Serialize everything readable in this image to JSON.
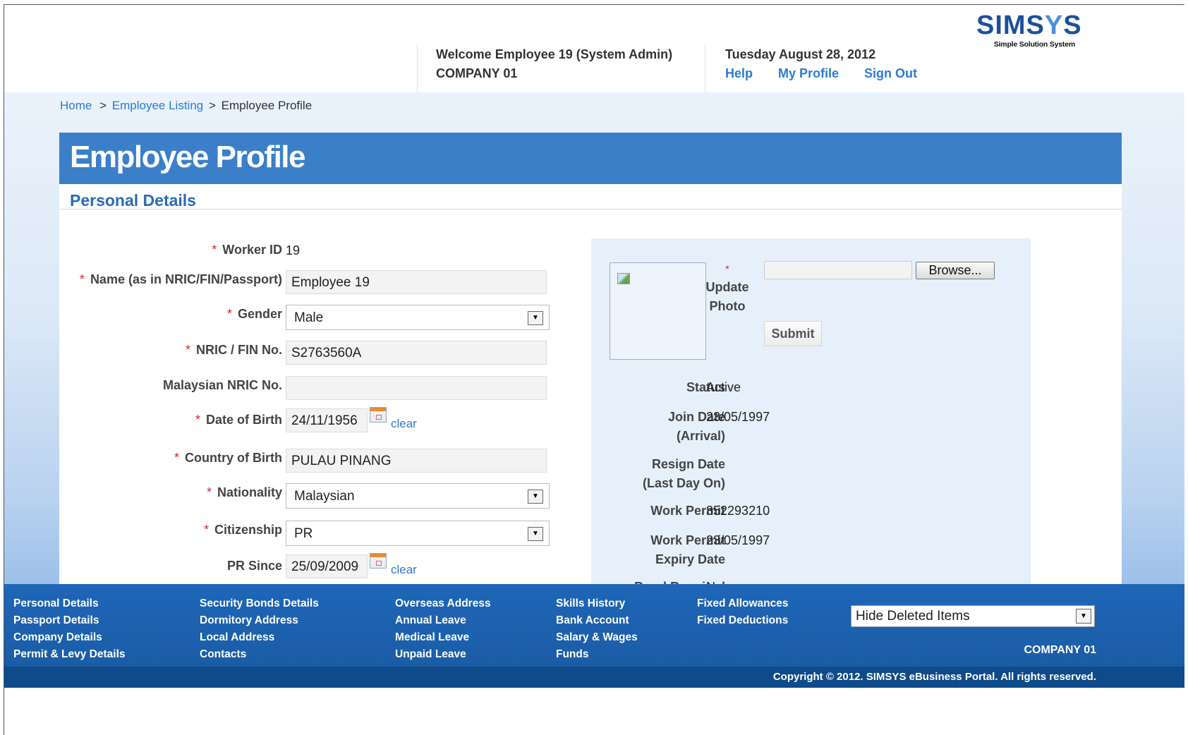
{
  "header": {
    "welcome_line1": "Welcome Employee 19 (System Admin)",
    "welcome_line2": "COMPANY 01",
    "date": "Tuesday August 28, 2012",
    "links": {
      "help": "Help",
      "my_profile": "My Profile",
      "sign_out": "Sign Out"
    },
    "logo": {
      "main_a": "SIMS",
      "main_b": "Y",
      "main_c": "S",
      "sub": "Simple Solution System"
    }
  },
  "breadcrumb": {
    "home": "Home",
    "sep1": ">",
    "listing": "Employee Listing",
    "sep2": ">",
    "current": "Employee Profile"
  },
  "page_title": "Employee Profile",
  "section_title": "Personal Details",
  "form": {
    "worker_id": {
      "label": "Worker ID",
      "value": "19"
    },
    "name": {
      "label": "Name (as in NRIC/FIN/Passport)",
      "value": "Employee 19"
    },
    "gender": {
      "label": "Gender",
      "value": "Male"
    },
    "nric": {
      "label": "NRIC / FIN No.",
      "value": "S2763560A"
    },
    "malaysian_nric": {
      "label": "Malaysian NRIC No.",
      "value": ""
    },
    "dob": {
      "label": "Date of Birth",
      "value": "24/11/1956",
      "clear": "clear"
    },
    "country_of_birth": {
      "label": "Country of Birth",
      "value": "PULAU PINANG"
    },
    "nationality": {
      "label": "Nationality",
      "value": "Malaysian"
    },
    "citizenship": {
      "label": "Citizenship",
      "value": "PR"
    },
    "pr_since": {
      "label": "PR Since",
      "value": "25/09/2009",
      "clear": "clear"
    },
    "required_mark": "*"
  },
  "photo_box": {
    "update_label_line1": "Update",
    "update_label_line2": "Photo",
    "browse": "Browse...",
    "submit": "Submit"
  },
  "info": {
    "status": {
      "label": "Status",
      "value": "Active"
    },
    "join_date": {
      "label1": "Join Date",
      "label2": "(Arrival)",
      "value": "23/05/1997"
    },
    "resign_date": {
      "label1": "Resign Date",
      "label2": "(Last Day On)",
      "value": "-"
    },
    "work_permit": {
      "label": "Work Permit",
      "value": "352293210"
    },
    "wp_expiry": {
      "label1": "Work Permit",
      "label2": "Expiry Date",
      "value": "23/05/1997"
    },
    "bond_required": {
      "label": "Bond Required",
      "value": "No"
    }
  },
  "footer": {
    "col1": [
      "Personal Details",
      "Passport Details",
      "Company Details",
      "Permit & Levy Details"
    ],
    "col2": [
      "Security Bonds Details",
      "Dormitory Address",
      "Local Address",
      "Contacts"
    ],
    "col3": [
      "Overseas Address",
      "Annual Leave",
      "Medical Leave",
      "Unpaid Leave"
    ],
    "col4": [
      "Skills History",
      "Bank Account",
      "Salary & Wages",
      "Funds"
    ],
    "col5": [
      "Fixed Allowances",
      "Fixed Deductions"
    ],
    "filter_select": "Hide Deleted Items",
    "company": "COMPANY 01",
    "copyright": "Copyright © 2012. SIMSYS eBusiness Portal. All rights reserved."
  }
}
